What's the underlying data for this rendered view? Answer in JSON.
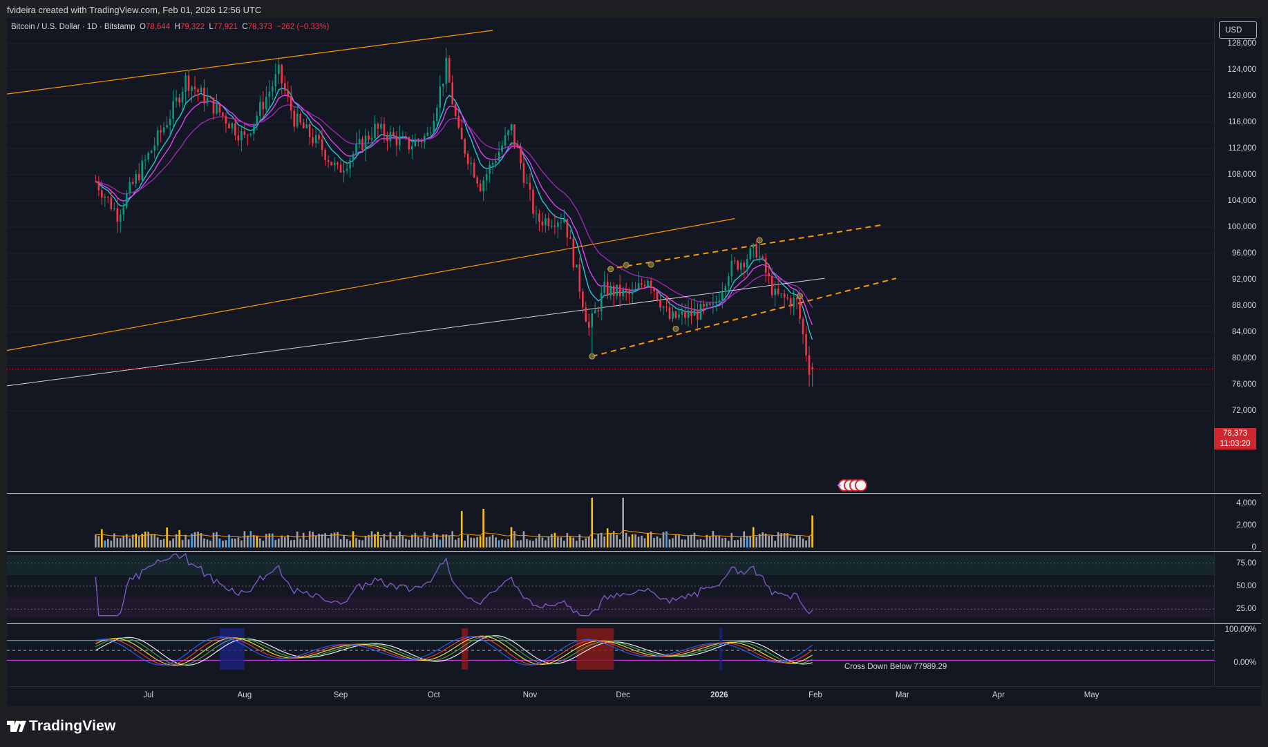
{
  "header": {
    "credit": "fvideira created with TradingView.com, Feb 01, 2026 12:56 UTC"
  },
  "legend": {
    "symbol": "Bitcoin / U.S. Dollar · 1D · Bitstamp",
    "o_label": "O",
    "o_value": "78,644",
    "h_label": "H",
    "h_value": "79,322",
    "l_label": "L",
    "l_value": "77,921",
    "c_label": "C",
    "c_value": "78,373",
    "change": "−262 (−0.33%)"
  },
  "currency": "USD",
  "price_axis": [
    "128,000",
    "124,000",
    "120,000",
    "116,000",
    "112,000",
    "108,000",
    "104,000",
    "100,000",
    "96,000",
    "92,000",
    "88,000",
    "84,000",
    "80,000",
    "76,000",
    "72,000"
  ],
  "price_tag": {
    "price": "78,373",
    "countdown": "11:03:20"
  },
  "volume_axis": [
    "4,000",
    "2,000",
    "0"
  ],
  "rsi_axis": [
    "75.00",
    "50.00",
    "25.00"
  ],
  "stoch_axis": [
    "100.00%",
    "0.00%"
  ],
  "stoch_label": "Cross Down Below 77989.29",
  "time_axis": {
    "months": [
      "Jul",
      "Aug",
      "Sep",
      "Oct",
      "Nov",
      "Dec",
      "2026",
      "Feb",
      "Mar",
      "Apr",
      "May"
    ]
  },
  "brand": "TradingView",
  "colors": {
    "up": "#089981",
    "down": "#f23645",
    "ema_fast": "#26c6da",
    "ema_mid": "#e040fb",
    "ema_slow": "#9c27b0",
    "trendline": "#ff9800",
    "rsi": "#7e57c2",
    "background": "#131722"
  },
  "chart_data": {
    "type": "candlestick",
    "symbol": "BTCUSD",
    "interval": "1D",
    "ylim": [
      70500,
      130000
    ],
    "last": {
      "open": 78644,
      "high": 79322,
      "low": 77921,
      "close": 78373
    },
    "trend_path": [
      [
        "2025-06-15",
        107000
      ],
      [
        "2025-06-22",
        102000
      ],
      [
        "2025-06-27",
        106500
      ],
      [
        "2025-07-10",
        118000
      ],
      [
        "2025-07-14",
        122500
      ],
      [
        "2025-07-25",
        117500
      ],
      [
        "2025-08-02",
        113500
      ],
      [
        "2025-08-13",
        123500
      ],
      [
        "2025-08-18",
        116500
      ],
      [
        "2025-08-27",
        112000
      ],
      [
        "2025-09-01",
        108500
      ],
      [
        "2025-09-13",
        115000
      ],
      [
        "2025-09-24",
        112500
      ],
      [
        "2025-09-30",
        114000
      ],
      [
        "2025-10-06",
        124500
      ],
      [
        "2025-10-10",
        114000
      ],
      [
        "2025-10-17",
        106500
      ],
      [
        "2025-10-27",
        115000
      ],
      [
        "2025-11-04",
        101000
      ],
      [
        "2025-11-13",
        101500
      ],
      [
        "2025-11-21",
        84500
      ],
      [
        "2025-11-26",
        90500
      ],
      [
        "2025-12-05",
        89500
      ],
      [
        "2025-12-10",
        92500
      ],
      [
        "2025-12-17",
        86000
      ],
      [
        "2025-12-31",
        87500
      ],
      [
        "2026-01-05",
        93500
      ],
      [
        "2026-01-14",
        96500
      ],
      [
        "2026-01-20",
        89500
      ],
      [
        "2026-01-27",
        88500
      ],
      [
        "2026-01-31",
        78500
      ]
    ],
    "volume_spikes": [
      {
        "date": "2025-10-10",
        "value": 3300
      },
      {
        "date": "2025-10-17",
        "value": 3500
      },
      {
        "date": "2025-11-21",
        "value": 4500
      },
      {
        "date": "2025-12-01",
        "value": 4500
      },
      {
        "date": "2026-01-31",
        "value": 2900
      }
    ]
  }
}
